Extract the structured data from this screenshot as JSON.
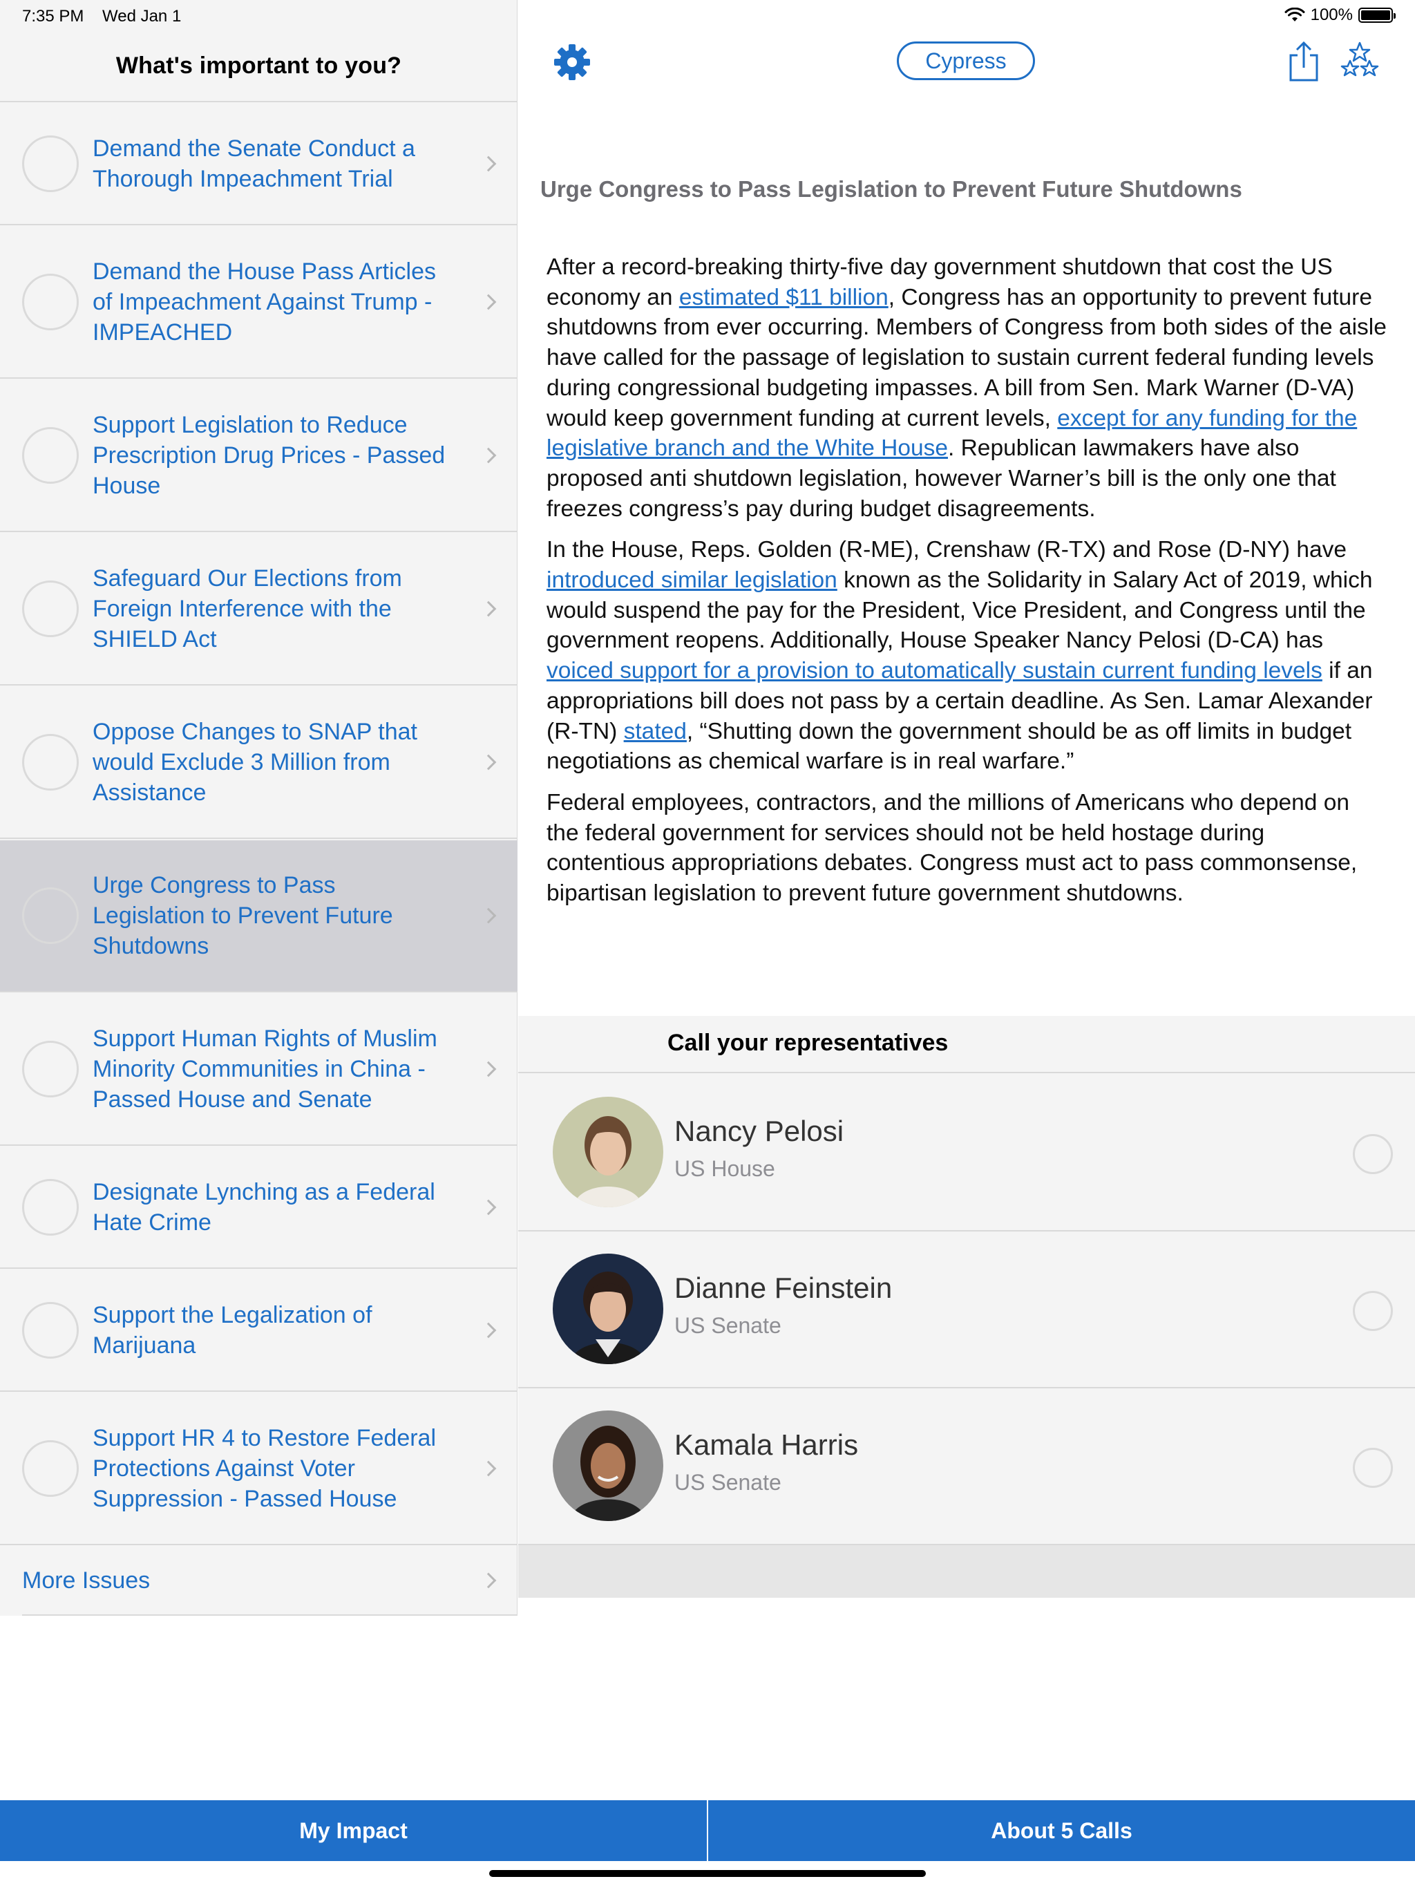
{
  "status": {
    "time": "7:35 PM",
    "date": "Wed Jan 1",
    "battery": "100%"
  },
  "sidebar": {
    "title": "What's important to you?",
    "issues": [
      {
        "label": "Demand the Senate Conduct a Thorough Impeachment Trial"
      },
      {
        "label": "Demand the House Pass Articles of Impeachment Against Trump - IMPEACHED"
      },
      {
        "label": "Support Legislation to Reduce Prescription Drug Prices - Passed House"
      },
      {
        "label": "Safeguard Our Elections from Foreign Interference with the SHIELD Act"
      },
      {
        "label": "Oppose Changes to SNAP that would Exclude 3 Million from Assistance"
      },
      {
        "label": "Urge Congress to Pass Legislation to Prevent Future Shutdowns",
        "selected": true
      },
      {
        "label": "Support Human Rights of Muslim Minority Communities in China - Passed House and Senate"
      },
      {
        "label": "Designate Lynching as a Federal Hate Crime"
      },
      {
        "label": "Support the Legalization of Marijuana"
      },
      {
        "label": "Support HR 4 to Restore Federal Protections Against Voter Suppression - Passed House"
      }
    ],
    "more_label": "More Issues"
  },
  "toolbar": {
    "location": "Cypress"
  },
  "issue": {
    "title": "Urge Congress to Pass Legislation to Prevent Future Shutdowns",
    "p1": {
      "a": "After a record-breaking thirty-five day government shutdown that cost the US economy an ",
      "link1": "estimated $11 billion",
      "b": ", Congress has an opportunity to prevent future shutdowns from ever occurring. Members of Congress from both sides of the aisle have called for the passage of legislation to sustain current federal funding levels during congressional budgeting impasses. A bill from Sen. Mark Warner (D-VA) would keep government funding at current levels, ",
      "link2": "except for any funding for the legislative branch and the White House",
      "c": ". Republican lawmakers have also proposed anti shutdown legislation, however Warner’s bill is the only one that freezes congress’s pay during budget disagreements."
    },
    "p2": {
      "a": "In the House, Reps. Golden (R-ME), Crenshaw (R-TX) and Rose (D-NY) have ",
      "link1": "introduced similar legislation",
      "b": " known as the Solidarity in Salary Act of 2019, which would suspend the pay for the President, Vice President, and Congress until the government reopens. Additionally, House Speaker Nancy Pelosi (D-CA) has ",
      "link2": "voiced support for a provision to automatically sustain current funding levels",
      "c": " if an appropriations bill does not pass by a certain deadline. As Sen. Lamar Alexander (R-TN) ",
      "link3": "stated",
      "d": ", “Shutting down the government should be as off limits in budget negotiations as chemical warfare is in real warfare.”"
    },
    "p3": "Federal employees, contractors, and the millions of Americans who depend on the federal government for services should not be held hostage during contentious appropriations debates. Congress must act to pass commonsense, bipartisan legislation to prevent future government shutdowns."
  },
  "representatives": {
    "header": "Call your representatives",
    "list": [
      {
        "name": "Nancy Pelosi",
        "office": "US House"
      },
      {
        "name": "Dianne Feinstein",
        "office": "US Senate"
      },
      {
        "name": "Kamala Harris",
        "office": "US Senate"
      }
    ]
  },
  "tabs": {
    "impact": "My Impact",
    "about": "About 5 Calls"
  },
  "colors": {
    "accent": "#1e6fc6",
    "tabbar": "#1f6fc9",
    "selected_row": "#d1d1d6"
  }
}
